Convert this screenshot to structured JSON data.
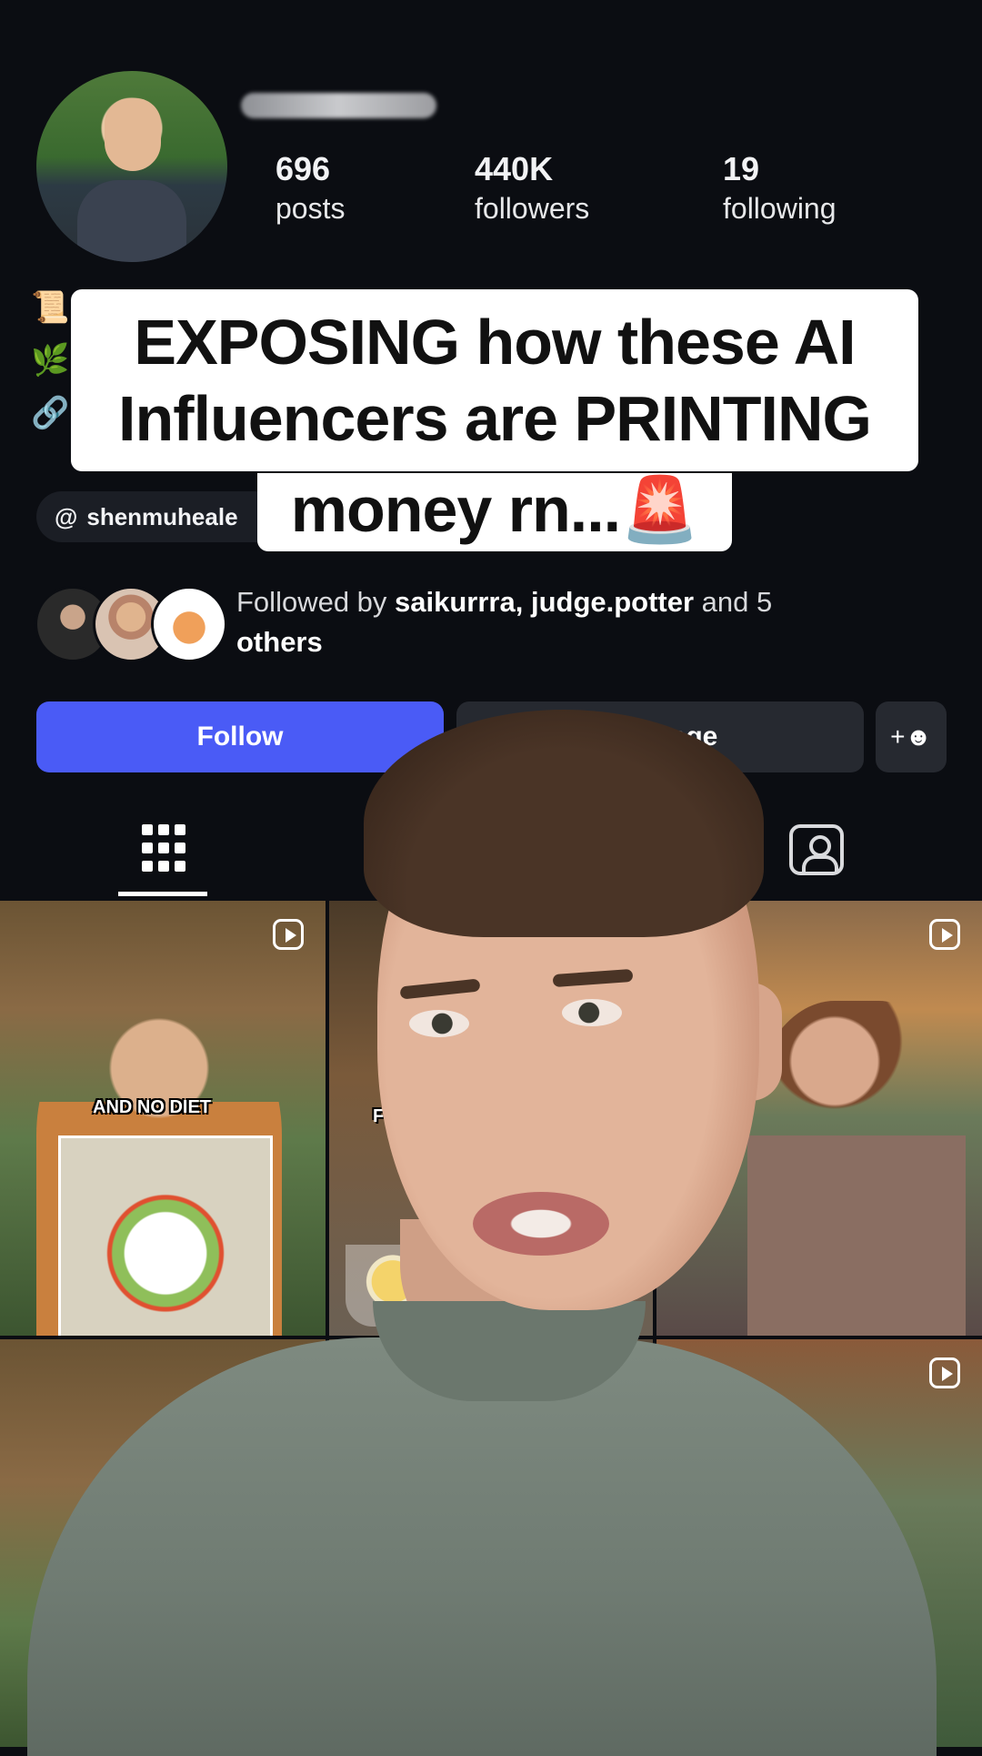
{
  "profile": {
    "stats": [
      {
        "value": "696",
        "label": "posts"
      },
      {
        "value": "440K",
        "label": "followers"
      },
      {
        "value": "19",
        "label": "following"
      }
    ],
    "threads_handle": "shenmuheale",
    "followed_by": {
      "prefix": "Followed by ",
      "names": "saikurrra, judge.potter",
      "suffix": " and 5",
      "suffix_line2": "others"
    },
    "buttons": {
      "follow": "Follow",
      "message": "Message"
    }
  },
  "overlay_caption": {
    "line1": "EXPOSING how these AI",
    "line2": "Influencers are PRINTING",
    "line3": "money rn...🚨"
  },
  "posts": [
    {
      "caption": "AND NO DIET"
    },
    {
      "caption": "FO"
    }
  ],
  "colors": {
    "background": "#0b0d12",
    "follow_button": "#4a5bf6",
    "secondary_button": "#262930"
  }
}
